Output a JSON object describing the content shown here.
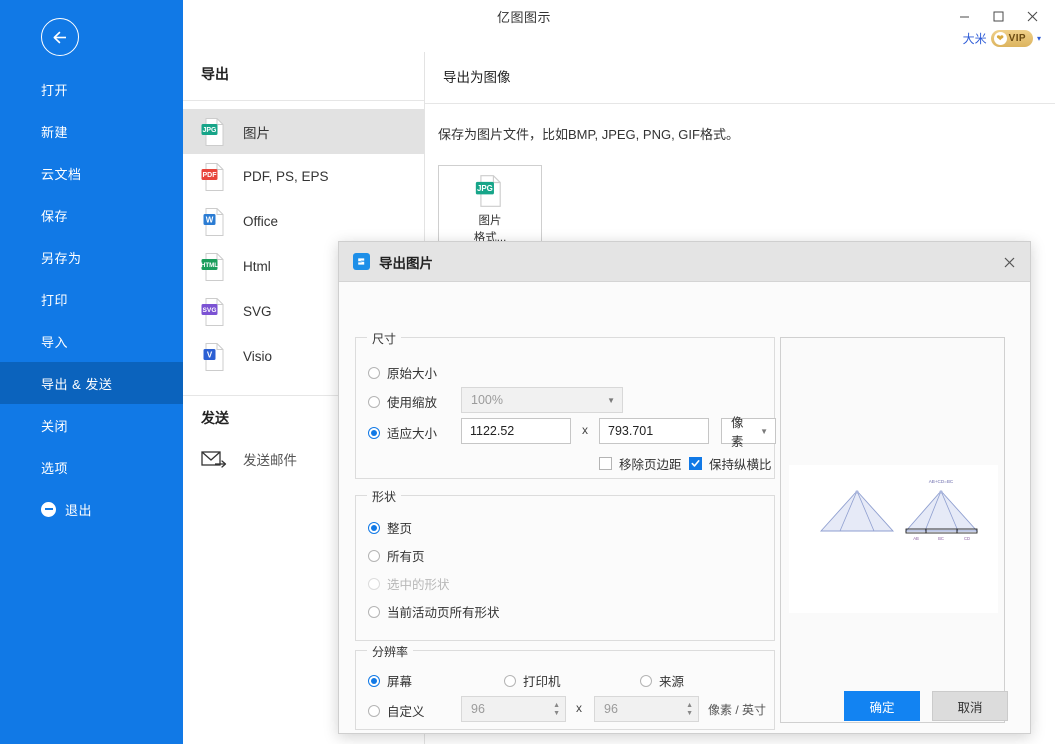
{
  "window": {
    "title": "亿图图示",
    "minimize": "–",
    "maximize": "□",
    "close": "✕"
  },
  "account": {
    "name": "大米",
    "badge": "VIP",
    "caret": "▾"
  },
  "sidebar": {
    "back_icon": "back-arrow-icon",
    "items": [
      {
        "label": "打开",
        "active": false
      },
      {
        "label": "新建",
        "active": false
      },
      {
        "label": "云文档",
        "active": false
      },
      {
        "label": "保存",
        "active": false
      },
      {
        "label": "另存为",
        "active": false
      },
      {
        "label": "打印",
        "active": false
      },
      {
        "label": "导入",
        "active": false
      },
      {
        "label": "导出 & 发送",
        "active": true
      },
      {
        "label": "关闭",
        "active": false
      },
      {
        "label": "选项",
        "active": false
      },
      {
        "label": "退出",
        "active": false,
        "icon": "minus-circle-icon"
      }
    ]
  },
  "export_column": {
    "heading": "导出",
    "formats": [
      {
        "label": "图片",
        "badge": "JPG",
        "badge_color": "#17a589",
        "selected": true
      },
      {
        "label": "PDF, PS, EPS",
        "badge": "PDF",
        "badge_color": "#e8453c",
        "selected": false
      },
      {
        "label": "Office",
        "badge": "W",
        "badge_color": "#2b7cd3",
        "selected": false
      },
      {
        "label": "Html",
        "badge": "HTML",
        "badge_color": "#1a9e5c",
        "selected": false
      },
      {
        "label": "SVG",
        "badge": "SVG",
        "badge_color": "#7b52d3",
        "selected": false
      },
      {
        "label": "Visio",
        "badge": "V",
        "badge_color": "#2b5fd3",
        "selected": false
      }
    ],
    "send_heading": "发送",
    "send_items": [
      {
        "label": "发送邮件",
        "icon": "mail-send-icon"
      }
    ]
  },
  "right_panel": {
    "title": "导出为图像",
    "description": "保存为图片文件，比如BMP, JPEG, PNG, GIF格式。",
    "card": {
      "badge": "JPG",
      "badge_color": "#17a589",
      "line1": "图片",
      "line2": "格式..."
    }
  },
  "dialog": {
    "title": "导出图片",
    "logo_glyph": "Ə",
    "close_icon": "close-icon",
    "size_section": {
      "legend": "尺寸",
      "original": {
        "label": "原始大小",
        "checked": false
      },
      "use_scale": {
        "label": "使用缩放",
        "checked": false,
        "value": "100%",
        "disabled": true
      },
      "fit_size": {
        "label": "适应大小",
        "checked": true
      },
      "width_value": "1122.52",
      "separator": "x",
      "height_value": "793.701",
      "unit_value": "像素",
      "remove_margin": {
        "label": "移除页边距",
        "checked": false
      },
      "keep_ratio": {
        "label": "保持纵横比",
        "checked": true
      }
    },
    "shape_section": {
      "legend": "形状",
      "options": [
        {
          "label": "整页",
          "checked": true,
          "disabled": false
        },
        {
          "label": "所有页",
          "checked": false,
          "disabled": false
        },
        {
          "label": "选中的形状",
          "checked": false,
          "disabled": true
        },
        {
          "label": "当前活动页所有形状",
          "checked": false,
          "disabled": false
        }
      ]
    },
    "resolution_section": {
      "legend": "分辨率",
      "options": [
        {
          "label": "屏幕",
          "checked": true
        },
        {
          "label": "打印机",
          "checked": false
        },
        {
          "label": "来源",
          "checked": false
        }
      ],
      "custom": {
        "label": "自定义",
        "checked": false
      },
      "custom_x": "96",
      "separator": "x",
      "custom_y": "96",
      "unit": "像素 / 英寸"
    },
    "preview": {
      "label": "preview-canvas",
      "diagram_label_top": "AB+CD=BC",
      "diagram_label_left": "AB",
      "diagram_label_mid": "BC",
      "diagram_label_right": "CD"
    },
    "ok_label": "确定",
    "cancel_label": "取消"
  },
  "colors": {
    "brand_blue": "#1179e6",
    "accent_blue": "#1283f2",
    "sidebar_active": "#0b63bd",
    "dialog_header": "#e4e4e4"
  }
}
